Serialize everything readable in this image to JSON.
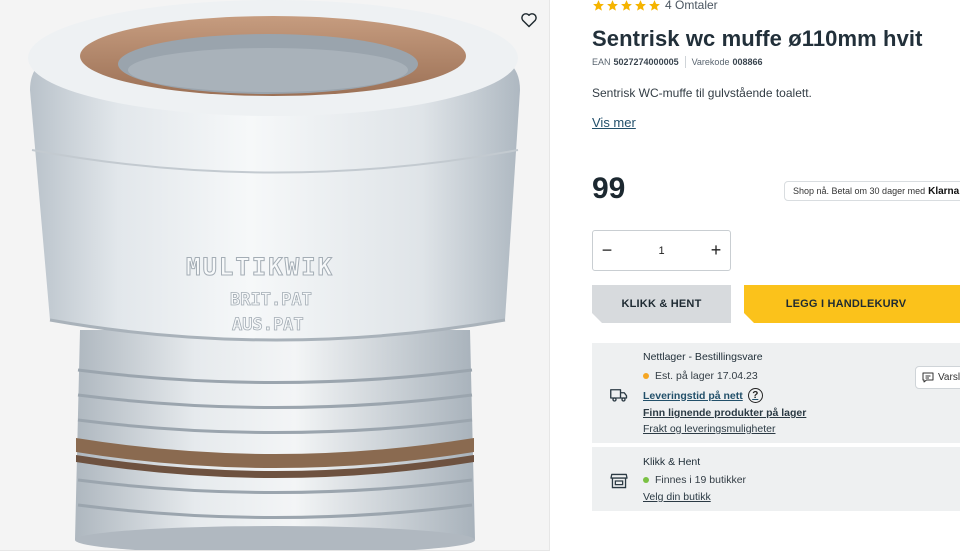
{
  "rating": {
    "stars": 5,
    "reviews_label": "4 Omtaler"
  },
  "product": {
    "title": "Sentrisk wc muffe ø110mm hvit",
    "ean_label": "EAN",
    "ean_value": "5027274000005",
    "varekode_label": "Varekode",
    "varekode_value": "008866",
    "description": "Sentrisk WC-muffe til gulvstående toalett.",
    "read_more": "Vis mer",
    "price": "99",
    "embossed_brand": "MULTIKWIK",
    "embossed_line1": "BRIT.PAT",
    "embossed_line2": "AUS.PAT"
  },
  "klarna": {
    "text": "Shop nå. Betal om 30 dager med",
    "brand": "Klarna"
  },
  "quantity": {
    "minus": "−",
    "value": "1",
    "plus": "+"
  },
  "buttons": {
    "click_collect": "KLIKK & HENT",
    "add_to_cart": "LEGG I HANDLEKURV"
  },
  "online_stock": {
    "heading": "Nettlager - Bestillingsvare",
    "status": "Est. på lager 17.04.23",
    "status_color": "#f5a623",
    "delivery_link": "Leveringstid på nett",
    "help_symbol": "?",
    "similar_link": "Finn lignende produkter på lager",
    "shipping_link": "Frakt og leveringsmuligheter",
    "icon": "truck-icon"
  },
  "click_collect": {
    "heading": "Klikk & Hent",
    "status": "Finnes i 19 butikker",
    "status_color": "#7ac143",
    "choose_store_link": "Velg din butikk",
    "icon": "store-icon"
  },
  "chat": {
    "label": "Varsle",
    "icon": "chat-icon"
  },
  "colors": {
    "accent_yellow": "#fbc21b",
    "grey_button": "#d7dadd",
    "info_bg": "#eef0f1",
    "link_blue": "#22506a"
  }
}
